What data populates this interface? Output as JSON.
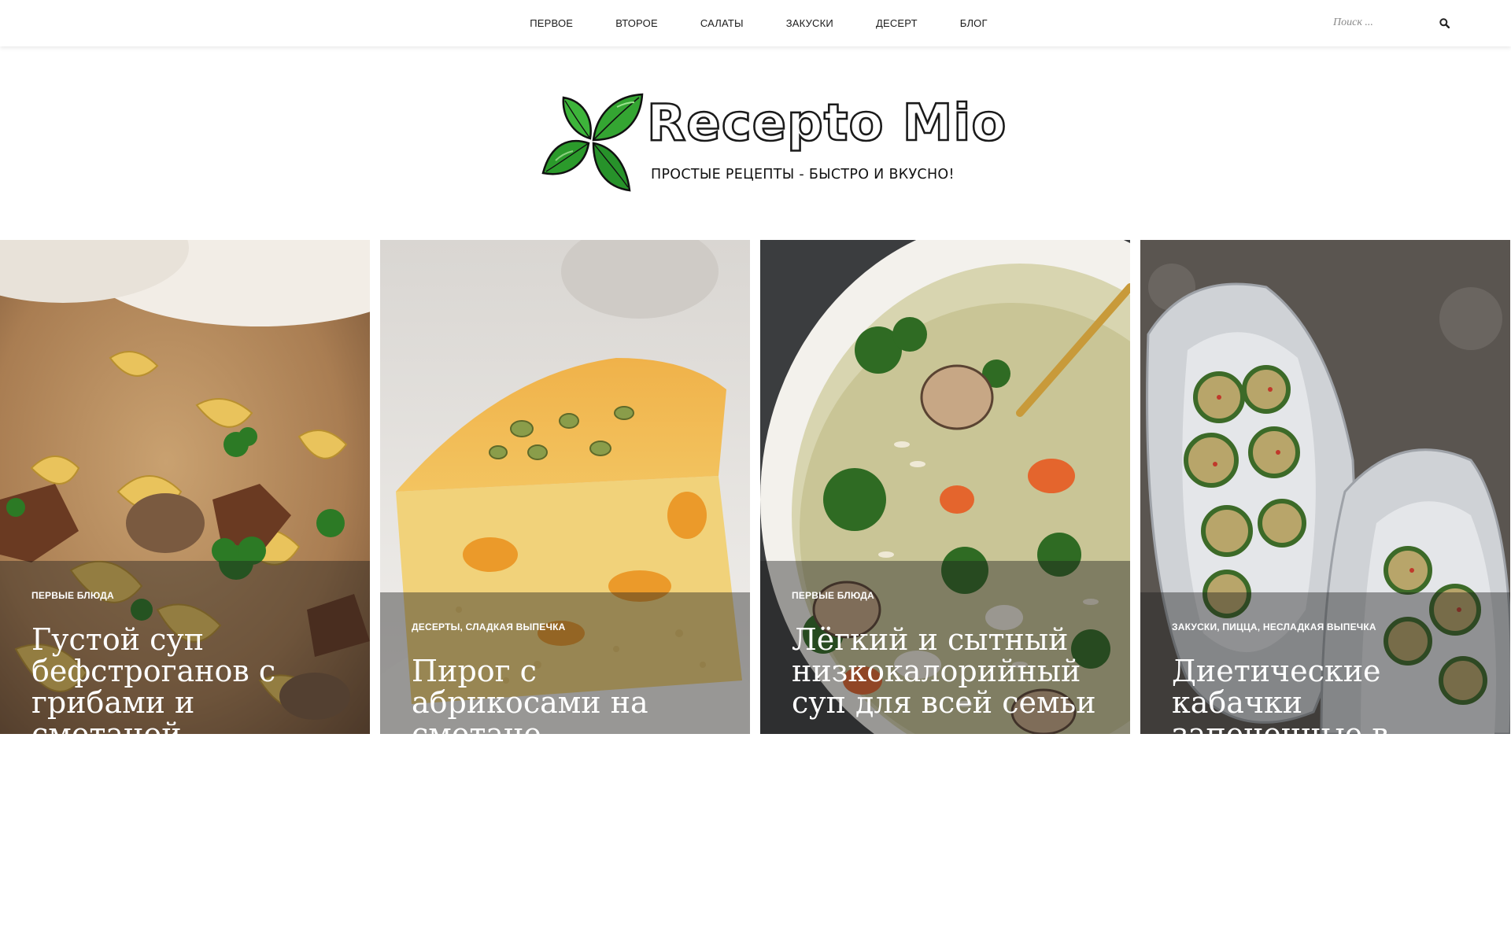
{
  "nav": {
    "items": [
      {
        "label": "ПЕРВОЕ"
      },
      {
        "label": "ВТОРОЕ"
      },
      {
        "label": "САЛАТЫ"
      },
      {
        "label": "ЗАКУСКИ"
      },
      {
        "label": "ДЕСЕРТ"
      },
      {
        "label": "БЛОГ"
      }
    ]
  },
  "search": {
    "placeholder": "Поиск ...",
    "icon": "magnifier-icon"
  },
  "logo": {
    "title": "Recepto Mio",
    "tagline": "ПРОСТЫЕ РЕЦЕПТЫ - БЫСТРО И ВКУСНО!",
    "icon": "basil-leaves-icon",
    "leaf_color": "#2f9e2f"
  },
  "cards": [
    {
      "categories": "ПЕРВЫЕ БЛЮДА",
      "title": "Густой суп бефстроганов с грибами и сметаной",
      "image": "beef-stroganoff-soup-photo"
    },
    {
      "categories": "ДЕСЕРТЫ, СЛАДКАЯ ВЫПЕЧКА",
      "title": "Пирог с абрикосами на сметане",
      "image": "apricot-pie-photo"
    },
    {
      "categories": "ПЕРВЫЕ БЛЮДА",
      "title": "Лёгкий и сытный низкокалорийный суп для всей семьи",
      "image": "vegetable-orzo-soup-photo"
    },
    {
      "categories": "ЗАКУСКИ, ПИЦЦА, НЕСЛАДКАЯ ВЫПЕЧКА",
      "title": "Диетические кабачки запеченные в духовке",
      "image": "baked-zucchini-foil-photo"
    }
  ]
}
